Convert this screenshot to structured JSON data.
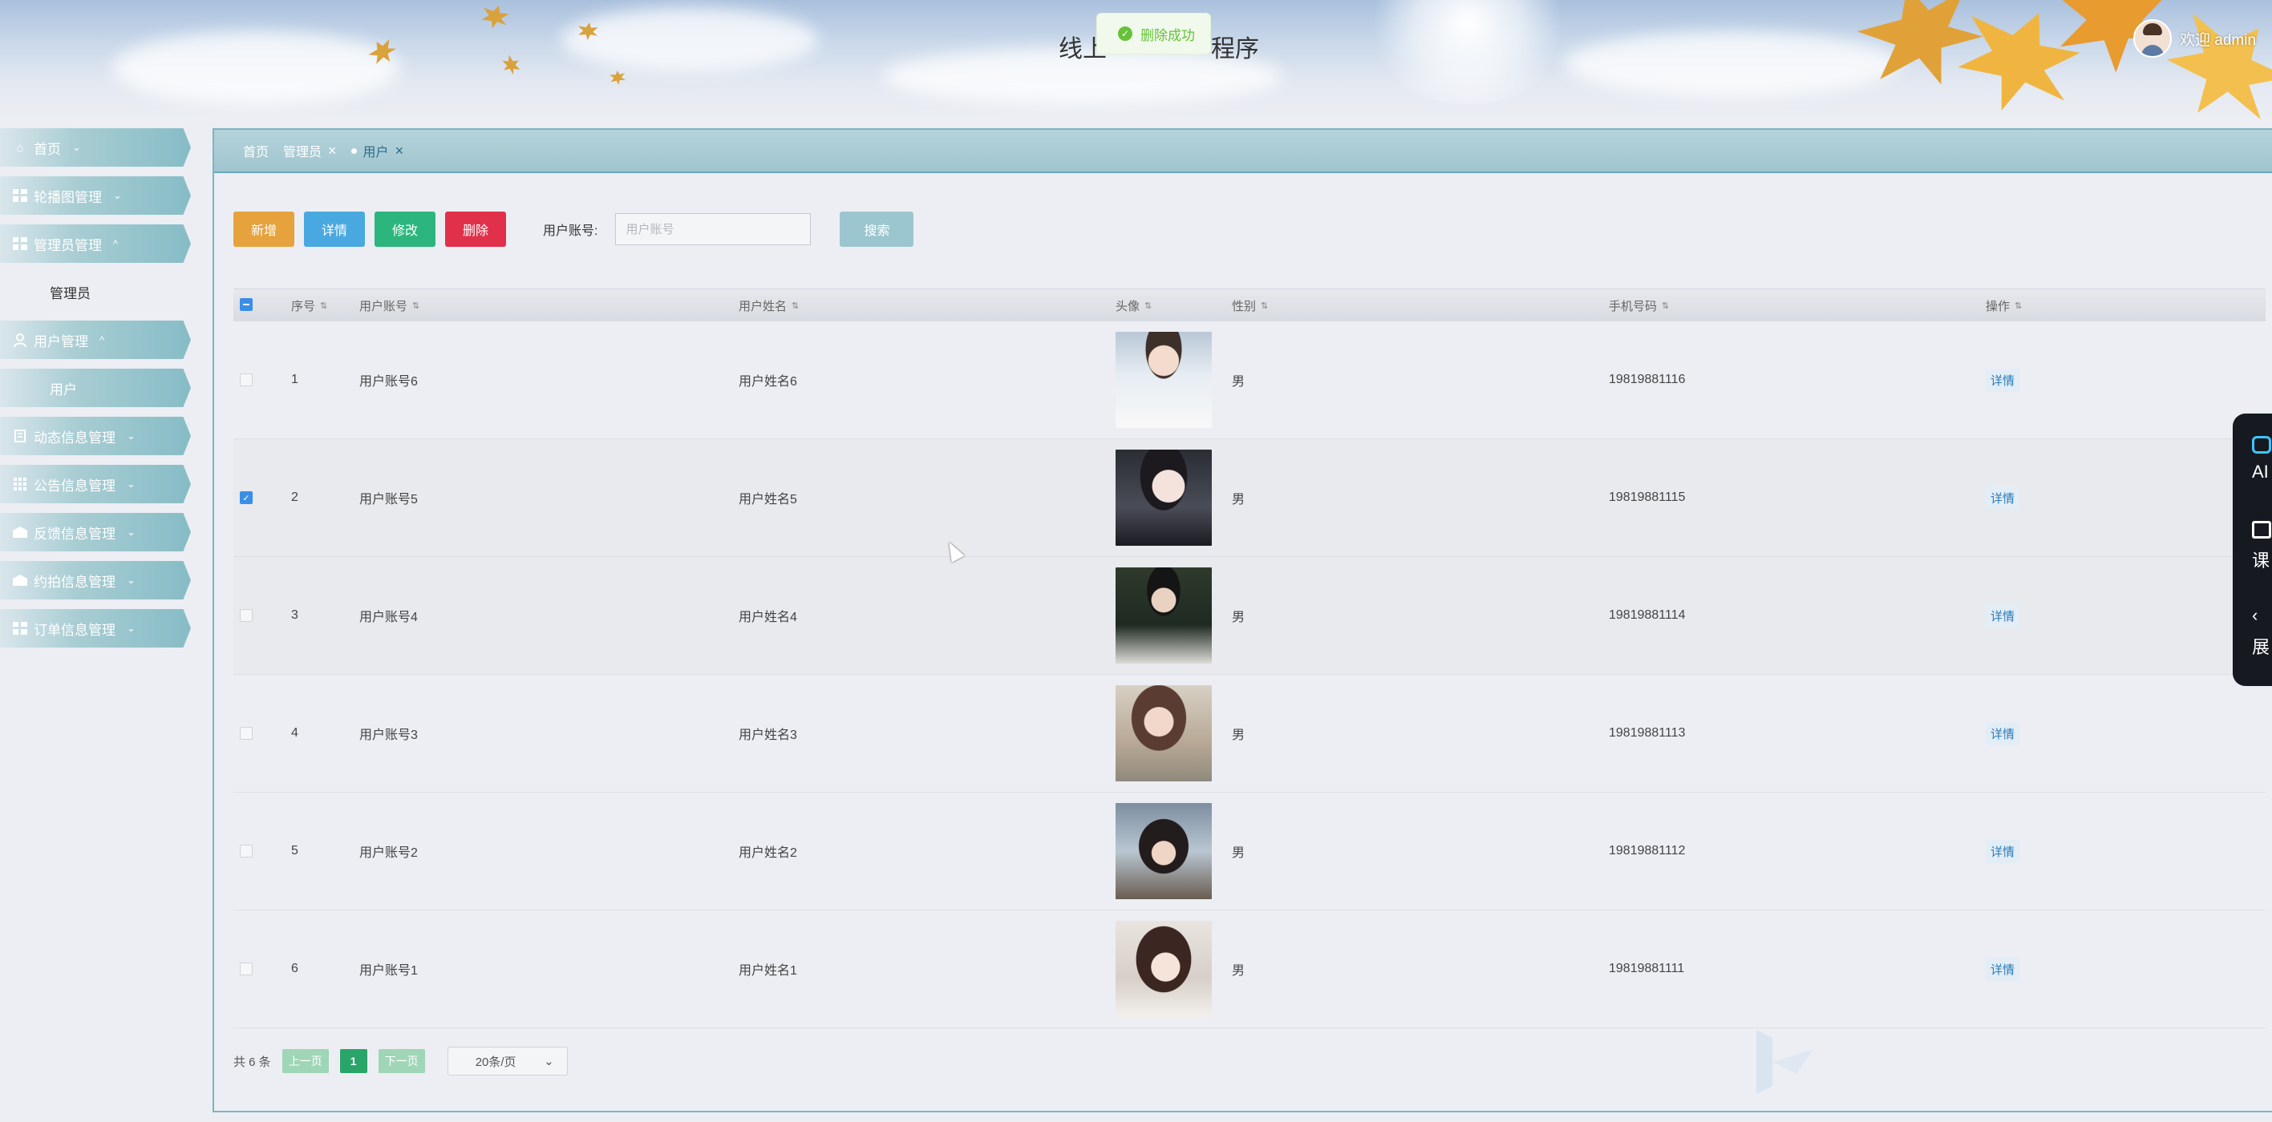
{
  "header": {
    "title_left": "线上",
    "title_right": "程序",
    "toast_text": "删除成功",
    "welcome": "欢迎 admin"
  },
  "sidebar": {
    "items": [
      {
        "label": "首页",
        "icon": "home-icon",
        "expanded": false
      },
      {
        "label": "轮播图管理",
        "icon": "grid-icon",
        "expanded": false
      },
      {
        "label": "管理员管理",
        "icon": "grid-icon",
        "expanded": true,
        "children": [
          "管理员"
        ]
      },
      {
        "label": "用户管理",
        "icon": "user-icon",
        "expanded": true,
        "children": [
          "用户"
        ]
      },
      {
        "label": "动态信息管理",
        "icon": "document-icon",
        "expanded": false
      },
      {
        "label": "公告信息管理",
        "icon": "apps-icon",
        "expanded": false
      },
      {
        "label": "反馈信息管理",
        "icon": "box-icon",
        "expanded": false
      },
      {
        "label": "约拍信息管理",
        "icon": "box-icon",
        "expanded": false
      },
      {
        "label": "订单信息管理",
        "icon": "grid-icon",
        "expanded": false
      }
    ]
  },
  "breadcrumb": {
    "home": "首页",
    "tab1": "管理员",
    "tab2": "用户"
  },
  "toolbar": {
    "add": "新增",
    "detail": "详情",
    "edit": "修改",
    "delete": "删除",
    "search_label": "用户账号:",
    "search_placeholder": "用户账号",
    "search": "搜索"
  },
  "table": {
    "headers": {
      "index": "序号",
      "account": "用户账号",
      "name": "用户姓名",
      "avatar": "头像",
      "gender": "性别",
      "phone": "手机号码",
      "action": "操作"
    },
    "rows": [
      {
        "index": "1",
        "account": "用户账号6",
        "name": "用户姓名6",
        "gender": "男",
        "phone": "19819881116",
        "action": "详情",
        "checked": false
      },
      {
        "index": "2",
        "account": "用户账号5",
        "name": "用户姓名5",
        "gender": "男",
        "phone": "19819881115",
        "action": "详情",
        "checked": true
      },
      {
        "index": "3",
        "account": "用户账号4",
        "name": "用户姓名4",
        "gender": "男",
        "phone": "19819881114",
        "action": "详情",
        "checked": false
      },
      {
        "index": "4",
        "account": "用户账号3",
        "name": "用户姓名3",
        "gender": "男",
        "phone": "19819881113",
        "action": "详情",
        "checked": false
      },
      {
        "index": "5",
        "account": "用户账号2",
        "name": "用户姓名2",
        "gender": "男",
        "phone": "19819881112",
        "action": "详情",
        "checked": false
      },
      {
        "index": "6",
        "account": "用户账号1",
        "name": "用户姓名1",
        "gender": "男",
        "phone": "19819881111",
        "action": "详情",
        "checked": false
      }
    ]
  },
  "pagination": {
    "total": "共 6 条",
    "prev": "上一页",
    "page": "1",
    "next": "下一页",
    "page_size": "20条/页"
  },
  "float_bar": {
    "ai": "AI",
    "course": "课",
    "expand": "展"
  },
  "colors": {
    "add": "#e6a23c",
    "detail": "#4aa8e0",
    "edit": "#2cb67d",
    "delete": "#e0304a",
    "search": "#9cc6cf",
    "accent": "#86bcc6"
  }
}
